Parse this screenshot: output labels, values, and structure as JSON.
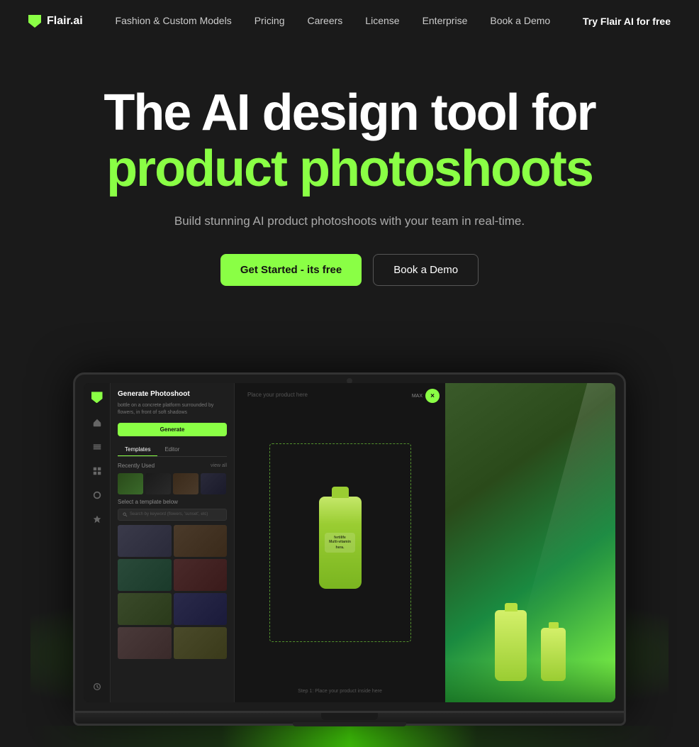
{
  "brand": {
    "name": "Flair.ai",
    "logo_icon": "flair-logo"
  },
  "nav": {
    "links": [
      {
        "id": "fashion-models",
        "label": "Fashion & Custom Models"
      },
      {
        "id": "pricing",
        "label": "Pricing"
      },
      {
        "id": "careers",
        "label": "Careers"
      },
      {
        "id": "license",
        "label": "License"
      },
      {
        "id": "enterprise",
        "label": "Enterprise"
      },
      {
        "id": "book-demo",
        "label": "Book a Demo"
      }
    ],
    "cta": "Try Flair AI  for free"
  },
  "hero": {
    "title_line1": "The AI design tool for",
    "title_line2": "product photoshoots",
    "subtitle": "Build stunning AI product photoshoots with your team in real-time.",
    "cta_primary": "Get Started - its free",
    "cta_secondary": "Book a Demo"
  },
  "app_mockup": {
    "panel_title": "Generate Photoshoot",
    "panel_description": "bottle on a concrete platform surrounded by flowers, in front of soft shadows",
    "generate_btn": "Generate",
    "tabs": [
      "Templates",
      "Editor"
    ],
    "active_tab": "Templates",
    "recently_used_label": "Recently Used",
    "view_all": "view all",
    "select_template_label": "Select a template below",
    "search_placeholder": "Search by keyword (flowers, 'sunset', etc)",
    "canvas_hint": "Place your product here",
    "canvas_footer": "Step 1: Place your product inside here",
    "controls_label": "MAX",
    "sidebar_icons": [
      "home",
      "layers",
      "elements",
      "frames",
      "ai",
      "history"
    ]
  },
  "colors": {
    "accent_green": "#8aff45",
    "bg_dark": "#1a1a1a",
    "text_primary": "#ffffff",
    "text_secondary": "#aaaaaa"
  }
}
